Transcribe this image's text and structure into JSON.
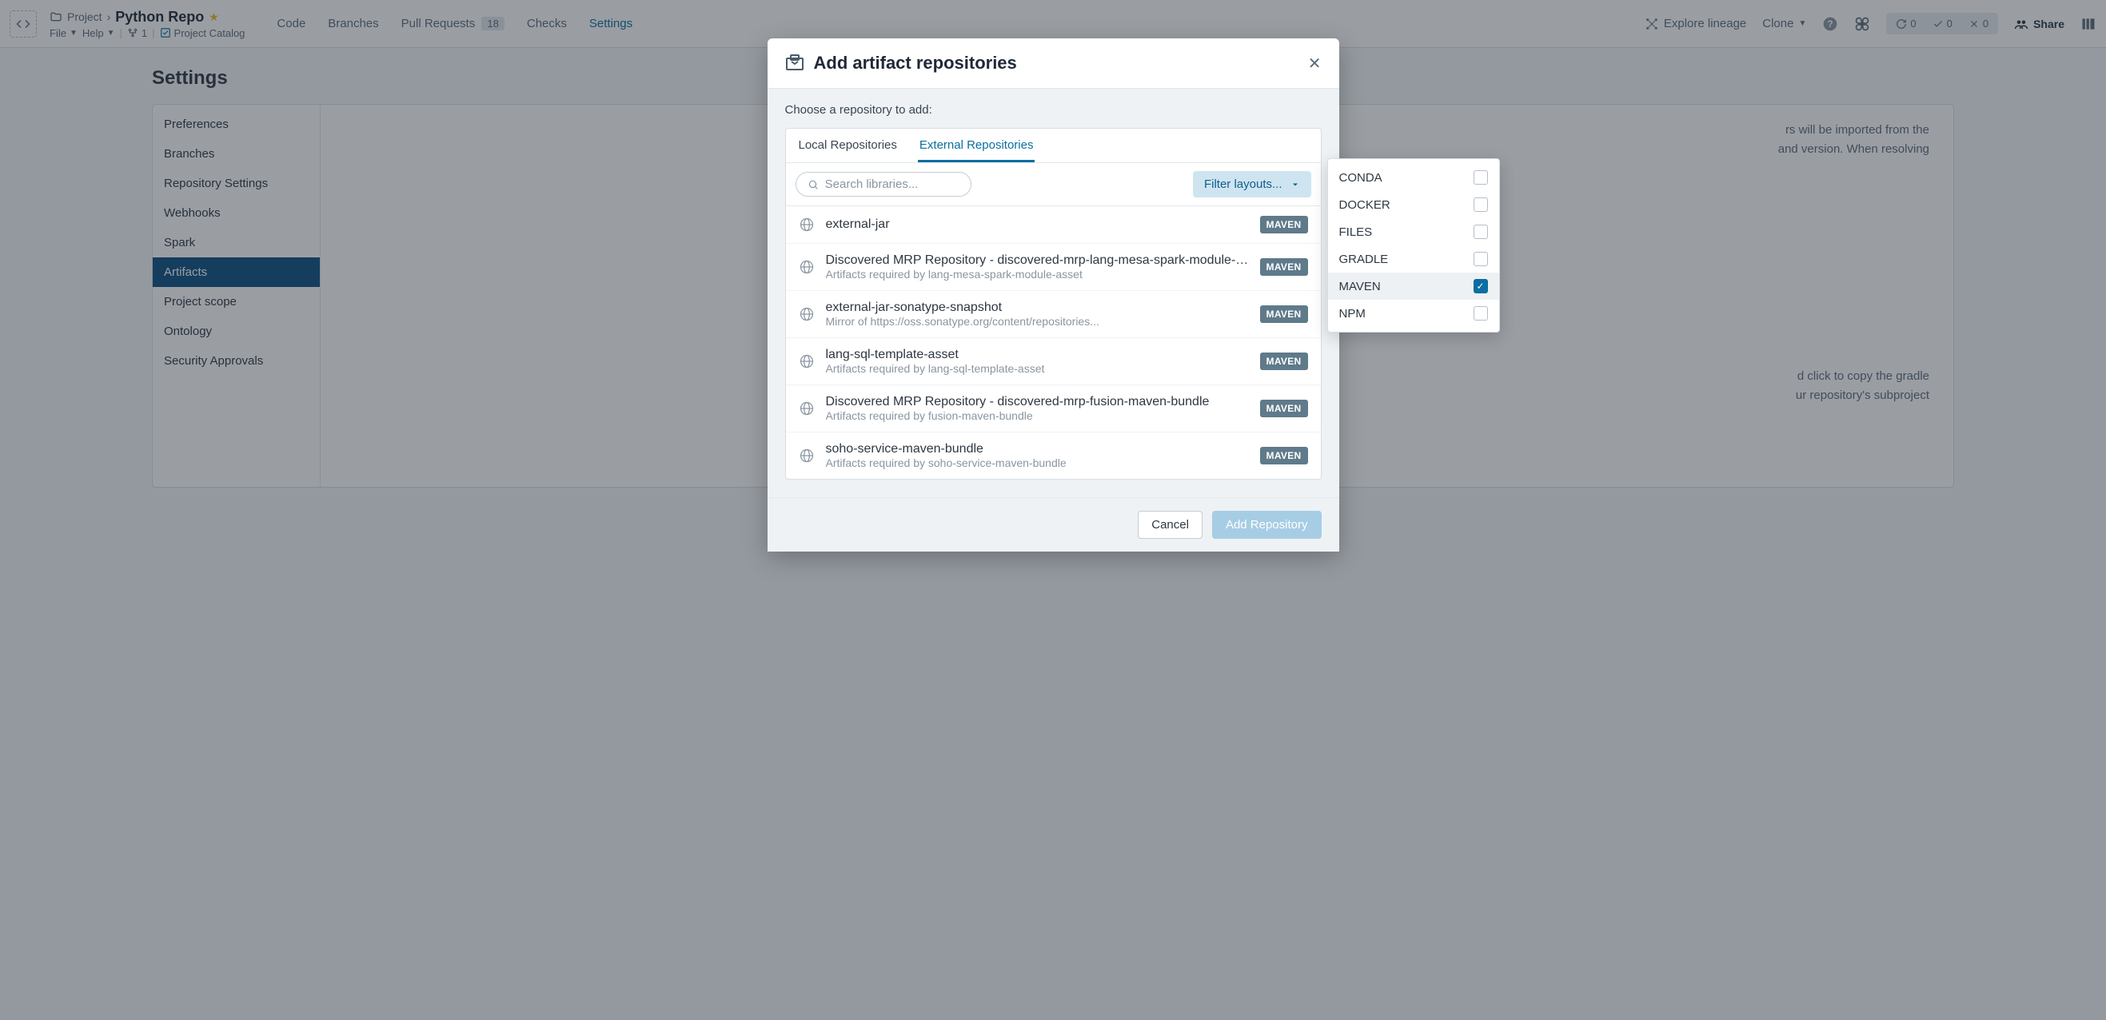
{
  "breadcrumb": {
    "parent": "Project",
    "title": "Python Repo"
  },
  "menus": {
    "file": "File",
    "help": "Help",
    "branch_count": "1",
    "catalog": "Project Catalog"
  },
  "nav": {
    "code": "Code",
    "branches": "Branches",
    "pull_requests": "Pull Requests",
    "pr_count": "18",
    "checks": "Checks",
    "settings": "Settings"
  },
  "toolbar": {
    "lineage": "Explore lineage",
    "clone": "Clone",
    "share": "Share",
    "counts": {
      "a": "0",
      "b": "0",
      "c": "0"
    }
  },
  "page": {
    "title": "Settings"
  },
  "sidebar": {
    "items": [
      "Preferences",
      "Branches",
      "Repository Settings",
      "Webhooks",
      "Spark",
      "Artifacts",
      "Project scope",
      "Ontology",
      "Security Approvals"
    ],
    "active_index": 5
  },
  "content": {
    "line1": "rs will be imported from the",
    "line2": "and version. When resolving",
    "line3": "d click to copy the gradle",
    "line4": "ur repository's subproject"
  },
  "modal": {
    "title": "Add artifact repositories",
    "prompt": "Choose a repository to add:",
    "tabs": {
      "local": "Local Repositories",
      "external": "External Repositories"
    },
    "search_placeholder": "Search libraries...",
    "filter_label": "Filter layouts...",
    "repos": [
      {
        "name": "external-jar",
        "desc": "",
        "badge": "MAVEN"
      },
      {
        "name": "Discovered MRP Repository - discovered-mrp-lang-mesa-spark-module-a...",
        "desc": "Artifacts required by lang-mesa-spark-module-asset",
        "badge": "MAVEN"
      },
      {
        "name": "external-jar-sonatype-snapshot",
        "desc": "Mirror of https://oss.sonatype.org/content/repositories...",
        "badge": "MAVEN"
      },
      {
        "name": "lang-sql-template-asset",
        "desc": "Artifacts required by lang-sql-template-asset",
        "badge": "MAVEN"
      },
      {
        "name": "Discovered MRP Repository - discovered-mrp-fusion-maven-bundle",
        "desc": "Artifacts required by fusion-maven-bundle",
        "badge": "MAVEN"
      },
      {
        "name": "soho-service-maven-bundle",
        "desc": "Artifacts required by soho-service-maven-bundle",
        "badge": "MAVEN"
      }
    ],
    "cancel": "Cancel",
    "add": "Add Repository"
  },
  "filter_popover": {
    "options": [
      {
        "label": "CONDA",
        "checked": false
      },
      {
        "label": "DOCKER",
        "checked": false
      },
      {
        "label": "FILES",
        "checked": false
      },
      {
        "label": "GRADLE",
        "checked": false
      },
      {
        "label": "MAVEN",
        "checked": true
      },
      {
        "label": "NPM",
        "checked": false
      }
    ]
  }
}
